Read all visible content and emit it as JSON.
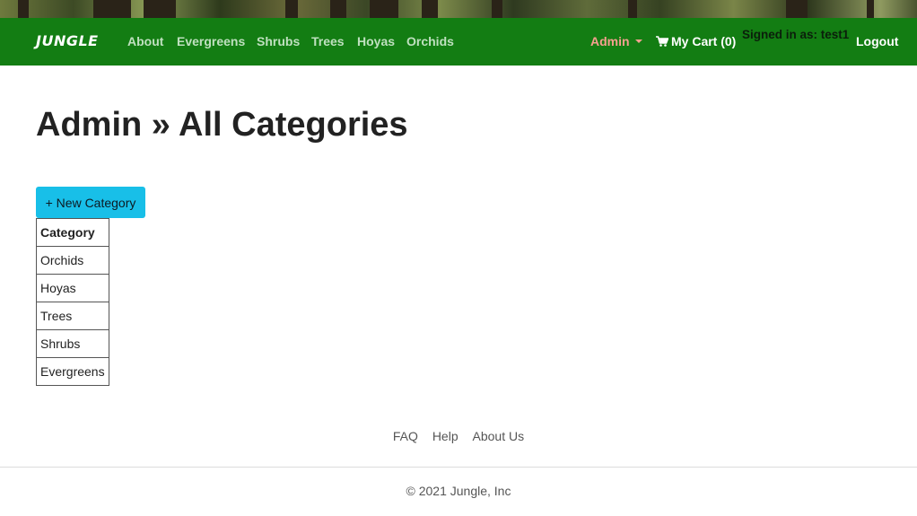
{
  "brand": {
    "name": "JUNGLE"
  },
  "nav": {
    "links": [
      "About",
      "Evergreens",
      "Shrubs",
      "Trees",
      "Hoyas",
      "Orchids"
    ],
    "admin_label": "Admin",
    "cart_label": "My Cart (0)",
    "signed_in": "Signed in as: test1",
    "logout_label": "Logout"
  },
  "main": {
    "title": "Admin » All Categories",
    "new_button": "+ New Category",
    "table": {
      "header": "Category",
      "rows": [
        "Orchids",
        "Hoyas",
        "Trees",
        "Shrubs",
        "Evergreens"
      ]
    }
  },
  "footer": {
    "links": [
      "FAQ",
      "Help",
      "About Us"
    ],
    "copyright": "© 2021 Jungle, Inc"
  },
  "colors": {
    "navbar": "#137d13",
    "nav_link": "#bfe0bf",
    "admin": "#f6a08f",
    "button": "#18bfe8"
  },
  "icons": {
    "cart": "shopping-cart-icon",
    "dropdown": "caret-down-icon"
  }
}
